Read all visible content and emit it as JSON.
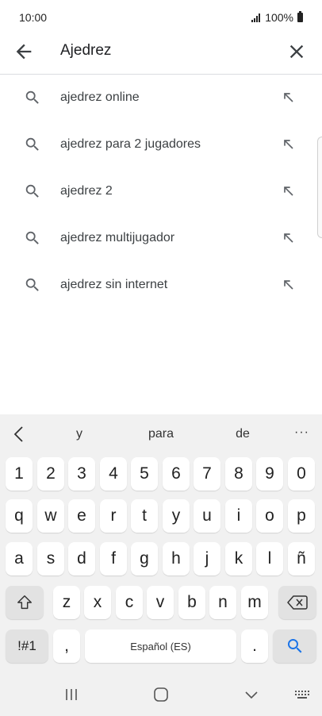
{
  "status_bar": {
    "time": "10:00",
    "battery": "100%"
  },
  "search": {
    "query": "Ajedrez"
  },
  "suggestions": [
    {
      "prefix": "ajedrez",
      "suffix": " online"
    },
    {
      "prefix": "ajedrez",
      "suffix": " para 2 jugadores"
    },
    {
      "prefix": "ajedrez",
      "suffix": " 2"
    },
    {
      "prefix": "ajedrez",
      "suffix": " multijugador"
    },
    {
      "prefix": "ajedrez",
      "suffix": " sin internet"
    }
  ],
  "keyboard": {
    "predictions": [
      "y",
      "para",
      "de"
    ],
    "more": "···",
    "row_numbers": [
      "1",
      "2",
      "3",
      "4",
      "5",
      "6",
      "7",
      "8",
      "9",
      "0"
    ],
    "row_top": [
      "q",
      "w",
      "e",
      "r",
      "t",
      "y",
      "u",
      "i",
      "o",
      "p"
    ],
    "row_mid": [
      "a",
      "s",
      "d",
      "f",
      "g",
      "h",
      "j",
      "k",
      "l",
      "ñ"
    ],
    "row_bottom": [
      "z",
      "x",
      "c",
      "v",
      "b",
      "n",
      "m"
    ],
    "symbols_label": "!#1",
    "comma": ",",
    "space_label": "Español (ES)",
    "period": "."
  },
  "colors": {
    "accent": "#1a73e8",
    "keyboard_bg": "#f1f1f1"
  }
}
